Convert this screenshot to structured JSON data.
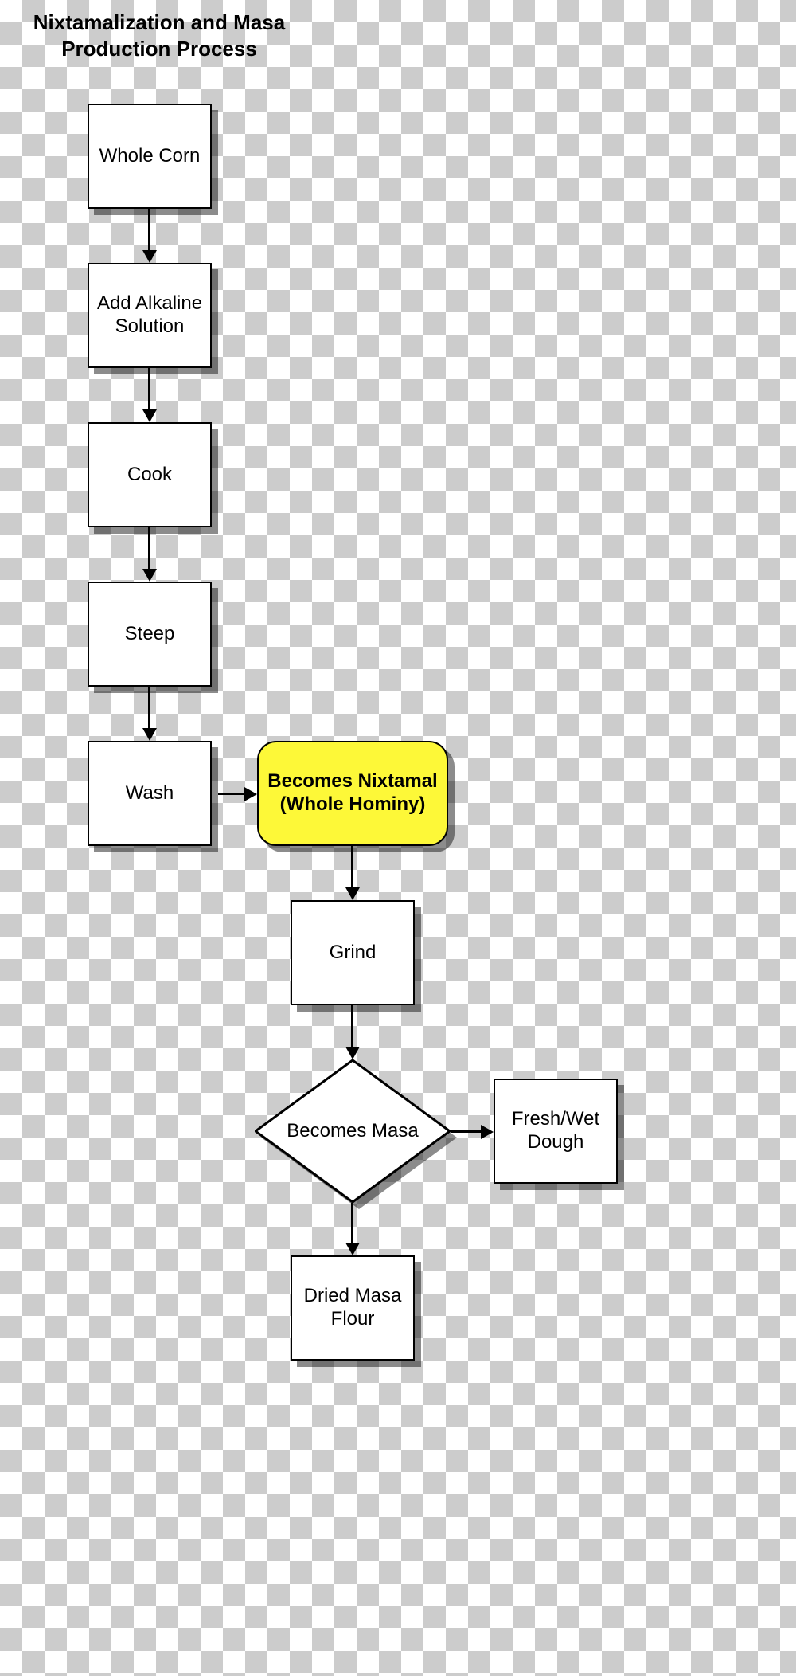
{
  "title": "Nixtamalization and Masa Production Process",
  "nodes": {
    "whole_corn": {
      "label": "Whole Corn"
    },
    "add_alkaline": {
      "label": "Add Alkaline Solution"
    },
    "cook": {
      "label": "Cook"
    },
    "steep": {
      "label": "Steep"
    },
    "wash": {
      "label": "Wash"
    },
    "nixtamal": {
      "label": "Becomes Nixtamal (Whole Hominy)"
    },
    "grind": {
      "label": "Grind"
    },
    "becomes_masa": {
      "label": "Becomes Masa"
    },
    "fresh_dough": {
      "label": "Fresh/Wet Dough"
    },
    "dried_flour": {
      "label": "Dried Masa Flour"
    }
  },
  "edges": [
    {
      "from": "whole_corn",
      "to": "add_alkaline"
    },
    {
      "from": "add_alkaline",
      "to": "cook"
    },
    {
      "from": "cook",
      "to": "steep"
    },
    {
      "from": "steep",
      "to": "wash"
    },
    {
      "from": "wash",
      "to": "nixtamal"
    },
    {
      "from": "nixtamal",
      "to": "grind"
    },
    {
      "from": "grind",
      "to": "becomes_masa"
    },
    {
      "from": "becomes_masa",
      "to": "fresh_dough"
    },
    {
      "from": "becomes_masa",
      "to": "dried_flour"
    }
  ],
  "colors": {
    "highlight_fill": "#fdf838",
    "box_fill": "#ffffff",
    "stroke": "#000000",
    "shadow": "rgba(0,0,0,0.45)"
  }
}
